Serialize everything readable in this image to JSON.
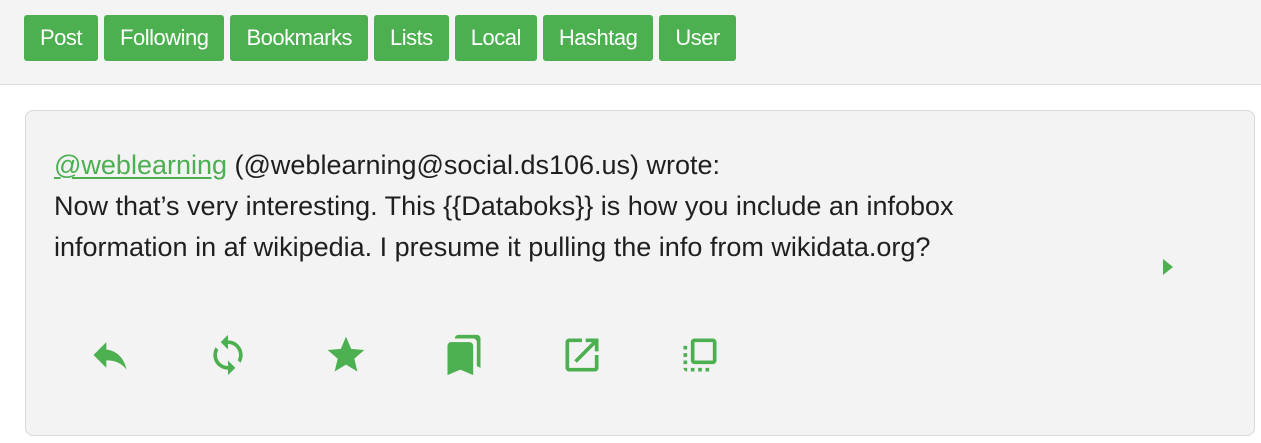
{
  "nav": {
    "buttons": [
      "Post",
      "Following",
      "Bookmarks",
      "Lists",
      "Local",
      "Hashtag",
      "User"
    ]
  },
  "post": {
    "author_handle": "@weblearning",
    "author_full": " (@weblearning@social.ds106.us) wrote:",
    "content": "Now that’s very interesting. This {{Databoks}} is how you include an infobox information in af wikipedia. I presume it pulling the info from wikidata.org?"
  },
  "actions": [
    {
      "name": "reply-icon"
    },
    {
      "name": "boost-icon"
    },
    {
      "name": "favourite-star-icon"
    },
    {
      "name": "bookmark-icon"
    },
    {
      "name": "open-external-icon"
    },
    {
      "name": "copy-icon"
    }
  ],
  "colors": {
    "accent": "#4caf50",
    "card_bg": "#f3f3f3",
    "nav_bg": "#f4f4f4",
    "text": "#1f1f1f"
  }
}
